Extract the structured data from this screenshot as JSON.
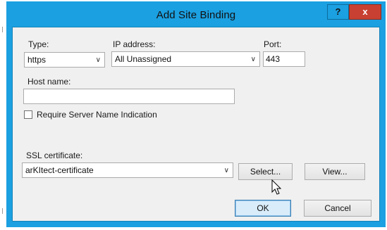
{
  "window": {
    "title": "Add Site Binding",
    "help_glyph": "?",
    "close_glyph": "x"
  },
  "form": {
    "type": {
      "label": "Type:",
      "value": "https"
    },
    "ip": {
      "label": "IP address:",
      "value": "All Unassigned"
    },
    "port": {
      "label": "Port:",
      "value": "443"
    },
    "host": {
      "label": "Host name:",
      "value": ""
    },
    "sni": {
      "label": "Require Server Name Indication",
      "checked": false
    },
    "ssl": {
      "label": "SSL certificate:",
      "value": "arKItect-certificate"
    }
  },
  "buttons": {
    "select": "Select...",
    "view": "View...",
    "ok": "OK",
    "cancel": "Cancel"
  },
  "icons": {
    "dropdown": "chevron-down-icon",
    "pointer": "mouse-pointer-icon"
  }
}
